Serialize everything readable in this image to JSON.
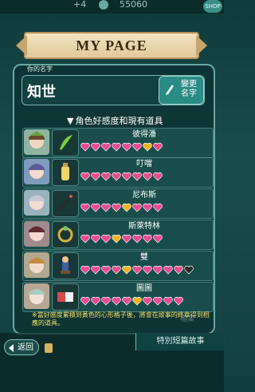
{
  "topbar": {
    "plus": "+4",
    "value": "55060",
    "badge": "SHOP"
  },
  "header": {
    "title": "MY PAGE"
  },
  "profile": {
    "name_label": "你的名字",
    "name_value": "知世",
    "rename_label": "變更\n名字"
  },
  "section": {
    "title": "角色好感度和現有道具"
  },
  "rows": [
    {
      "name": "彼得潘",
      "hearts": [
        "pink",
        "pink",
        "pink",
        "pink",
        "pink",
        "pink",
        "gold",
        "pink"
      ]
    },
    {
      "name": "叮噹",
      "hearts": [
        "pink",
        "pink",
        "pink",
        "pink",
        "pink",
        "pink",
        "pink",
        "pink"
      ]
    },
    {
      "name": "尼布斯",
      "hearts": [
        "pink",
        "pink",
        "pink",
        "pink",
        "gold",
        "pink",
        "pink",
        "pink"
      ]
    },
    {
      "name": "斯萊特林",
      "hearts": [
        "pink",
        "pink",
        "pink",
        "gold",
        "pink",
        "pink",
        "pink",
        "pink"
      ]
    },
    {
      "name": "雙",
      "hearts": [
        "pink",
        "pink",
        "pink",
        "pink",
        "gold",
        "pink",
        "pink",
        "pink",
        "pink",
        "pink",
        "black"
      ]
    },
    {
      "name": "圖圖",
      "hearts": [
        "pink",
        "pink",
        "pink",
        "pink",
        "pink",
        "gold",
        "pink",
        "pink",
        "pink",
        "pink"
      ]
    }
  ],
  "note": "※當好感度累積到黃色的心形格子後，將會在故事的終章得到相應的道具。",
  "bottom": {
    "back_label": "返回",
    "special_label": "特別短篇故事"
  },
  "deco": {
    "side_text": "檔案"
  },
  "colors": {
    "pink": "#e94b8f",
    "gold": "#f1b21f",
    "black": "#2b2b2b",
    "accent": "#2b8b86"
  }
}
